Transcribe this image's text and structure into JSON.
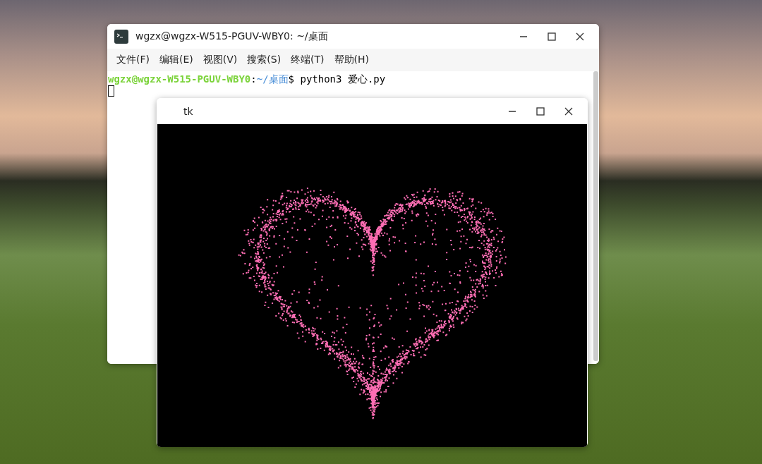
{
  "terminal": {
    "title": "wgzx@wgzx-W515-PGUV-WBY0: ~/桌面",
    "menu": [
      "文件(F)",
      "编辑(E)",
      "视图(V)",
      "搜索(S)",
      "终端(T)",
      "帮助(H)"
    ],
    "prompt": {
      "user_host": "wgzx@wgzx-W515-PGUV-WBY0",
      "separator": ":",
      "path": "~/桌面",
      "symbol": "$",
      "command": "python3 爱心.py"
    }
  },
  "tk_window": {
    "title": "tk"
  }
}
